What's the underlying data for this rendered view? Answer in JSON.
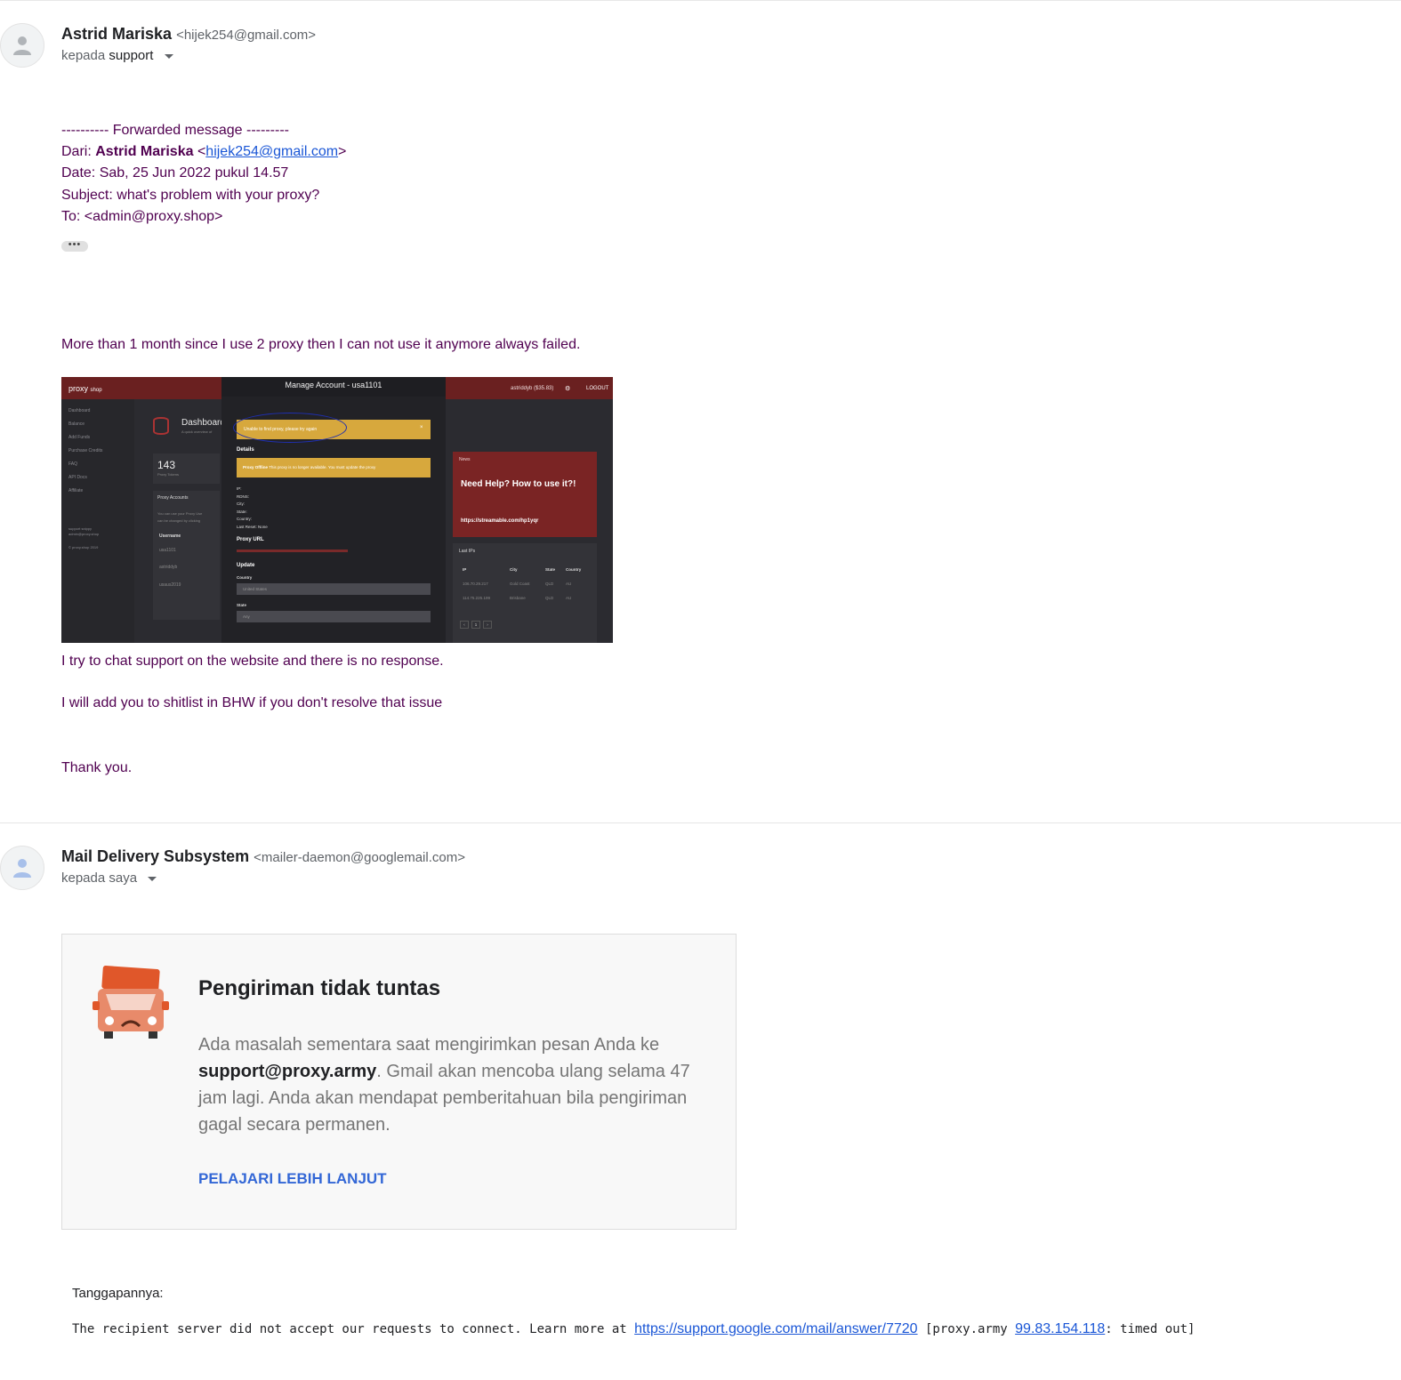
{
  "message1": {
    "sender_name": "Astrid Mariska",
    "sender_email": "<hijek254@gmail.com>",
    "to_prefix": "kepada",
    "to_recipient": "support",
    "fwd_header": "---------- Forwarded message ---------",
    "from_label": "Dari:",
    "from_name": "Astrid Mariska",
    "from_email": "hijek254@gmail.com",
    "date_line": "Date: Sab, 25 Jun 2022 pukul 14.57",
    "subject_line": "Subject: what's problem with your proxy?",
    "to_line": "To: <admin@proxy.shop>",
    "ellipsis": "•••",
    "body_line1": "More than 1 month since I use 2 proxy then I can not use it anymore always failed.",
    "body_line2": "I try to chat support on the website and there is no response.",
    "body_line3": "I will add you to shitlist in BHW if you don't resolve that issue",
    "body_line4": "Thank you."
  },
  "screenshot": {
    "brand": "proxy",
    "brand_suffix": "shop",
    "account": "astriddyb ($35.83)",
    "logout": "LOGOUT",
    "sidebar": [
      "Dashboard",
      "Balance",
      "Add Funds",
      "Purchase Credits",
      "FAQ",
      "API Docs",
      "Affiliate"
    ],
    "sidebar_footer1": "support snippy",
    "sidebar_footer2": "admin@proxy.shop",
    "sidebar_footer3": "© proxy.shop 2019",
    "dashboard_title": "Dashboard",
    "dashboard_sub": "A quick overview of",
    "stat_value": "143",
    "stat_label": "Proxy Tokens",
    "proxy_accounts": "Proxy Accounts",
    "proxy_accounts_note1": "You can use your Proxy Use",
    "proxy_accounts_note2": "can be changed by clicking",
    "username_header": "Username",
    "usernames": [
      "usa1101",
      "astriddyb",
      "usaus2019"
    ],
    "modal_title": "Manage Account - usa1101",
    "alert1": "Unable to find proxy, please try again",
    "details": "Details",
    "alert2_bold": "Proxy Offline",
    "alert2": "This proxy is no longer available. You must update the proxy",
    "fields": [
      "IP:",
      "RDNS:",
      "City:",
      "State:",
      "Country:",
      "Last Reset: None"
    ],
    "proxy_url": "Proxy URL",
    "update": "Update",
    "country_label": "Country",
    "country_value": "United States",
    "state_label": "State",
    "state_value": "Any",
    "news_label": "News",
    "news_title": "Need Help? How to use it?!",
    "news_link": "https://streamable.com/hp1yqr",
    "last_ips": "Last IPs",
    "ips_headers": [
      "IP",
      "City",
      "State",
      "Country"
    ],
    "ips_rows": [
      [
        "106.70.29.217",
        "Gold Coast",
        "QLD",
        "AU"
      ],
      [
        "114.75.225.199",
        "Brisbane",
        "QLD",
        "AU"
      ]
    ],
    "page": "1"
  },
  "message2": {
    "sender_name": "Mail Delivery Subsystem",
    "sender_email": "<mailer-daemon@googlemail.com>",
    "to_prefix": "kepada",
    "to_recipient": "saya",
    "card_title": "Pengiriman tidak tuntas",
    "card_msg_pre": "Ada masalah sementara saat mengirimkan pesan Anda ke ",
    "card_msg_email": "support@proxy.army",
    "card_msg_post": ". Gmail akan mencoba ulang selama 47 jam lagi. Anda akan mendapat pemberitahuan bila pengiriman gagal secara permanen.",
    "learn_more": "PELAJARI LEBIH LANJUT",
    "response_label": "Tanggapannya:",
    "response_pre": "The recipient server did not accept our requests to connect. Learn more at ",
    "response_link": "https://support.google.com/mail/answer/7720",
    "response_mid": " [proxy.army ",
    "response_ip": "99.83.154.118",
    "response_post": ": timed out]"
  },
  "colors": {
    "body_text": "#500050",
    "link": "#1a56d6",
    "learn_more": "#3367d6",
    "truck": "#e0572a"
  }
}
